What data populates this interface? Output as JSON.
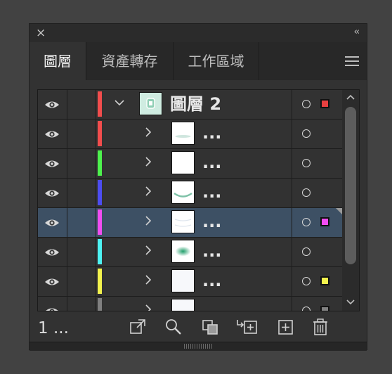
{
  "window": {
    "close_glyph": "×",
    "collapse_glyph": "‹‹"
  },
  "tabs": [
    {
      "label": "圖層",
      "active": true
    },
    {
      "label": "資產轉存",
      "active": false
    },
    {
      "label": "工作區域",
      "active": false
    }
  ],
  "layers": [
    {
      "name": "圖層 2",
      "kind": "layer",
      "expanded": true,
      "color": "#f24d4d",
      "selected_marker_color": "#e84040",
      "selected": false
    },
    {
      "name": "...",
      "kind": "sublayer",
      "expanded": false,
      "color": "#f24d4d",
      "selected_marker_color": null,
      "selected": false
    },
    {
      "name": "...",
      "kind": "sublayer",
      "expanded": false,
      "color": "#4df24d",
      "selected_marker_color": null,
      "selected": false
    },
    {
      "name": "...",
      "kind": "sublayer",
      "expanded": false,
      "color": "#4d4df2",
      "selected_marker_color": null,
      "selected": false
    },
    {
      "name": "...",
      "kind": "sublayer",
      "expanded": false,
      "color": "#f24df2",
      "selected_marker_color": "#f24df2",
      "selected": true
    },
    {
      "name": "...",
      "kind": "sublayer",
      "expanded": false,
      "color": "#4df2f2",
      "selected_marker_color": null,
      "selected": false
    },
    {
      "name": "...",
      "kind": "sublayer",
      "expanded": false,
      "color": "#f2f24d",
      "selected_marker_color": "#f2f24d",
      "selected": false
    },
    {
      "name": "...",
      "kind": "sublayer",
      "expanded": false,
      "color": "#808080",
      "selected_marker_color": "#808080",
      "selected": false
    }
  ],
  "footer": {
    "layer_count": "1 ...",
    "actions": [
      {
        "icon": "export-icon",
        "label": "Collect for export"
      },
      {
        "icon": "locate-object-icon",
        "label": "Locate object"
      },
      {
        "icon": "clipping-mask-icon",
        "label": "Make clipping mask"
      },
      {
        "icon": "new-sublayer-icon",
        "label": "Create new sublayer"
      },
      {
        "icon": "new-layer-icon",
        "label": "Create new layer"
      },
      {
        "icon": "trash-icon",
        "label": "Delete selection"
      }
    ]
  }
}
